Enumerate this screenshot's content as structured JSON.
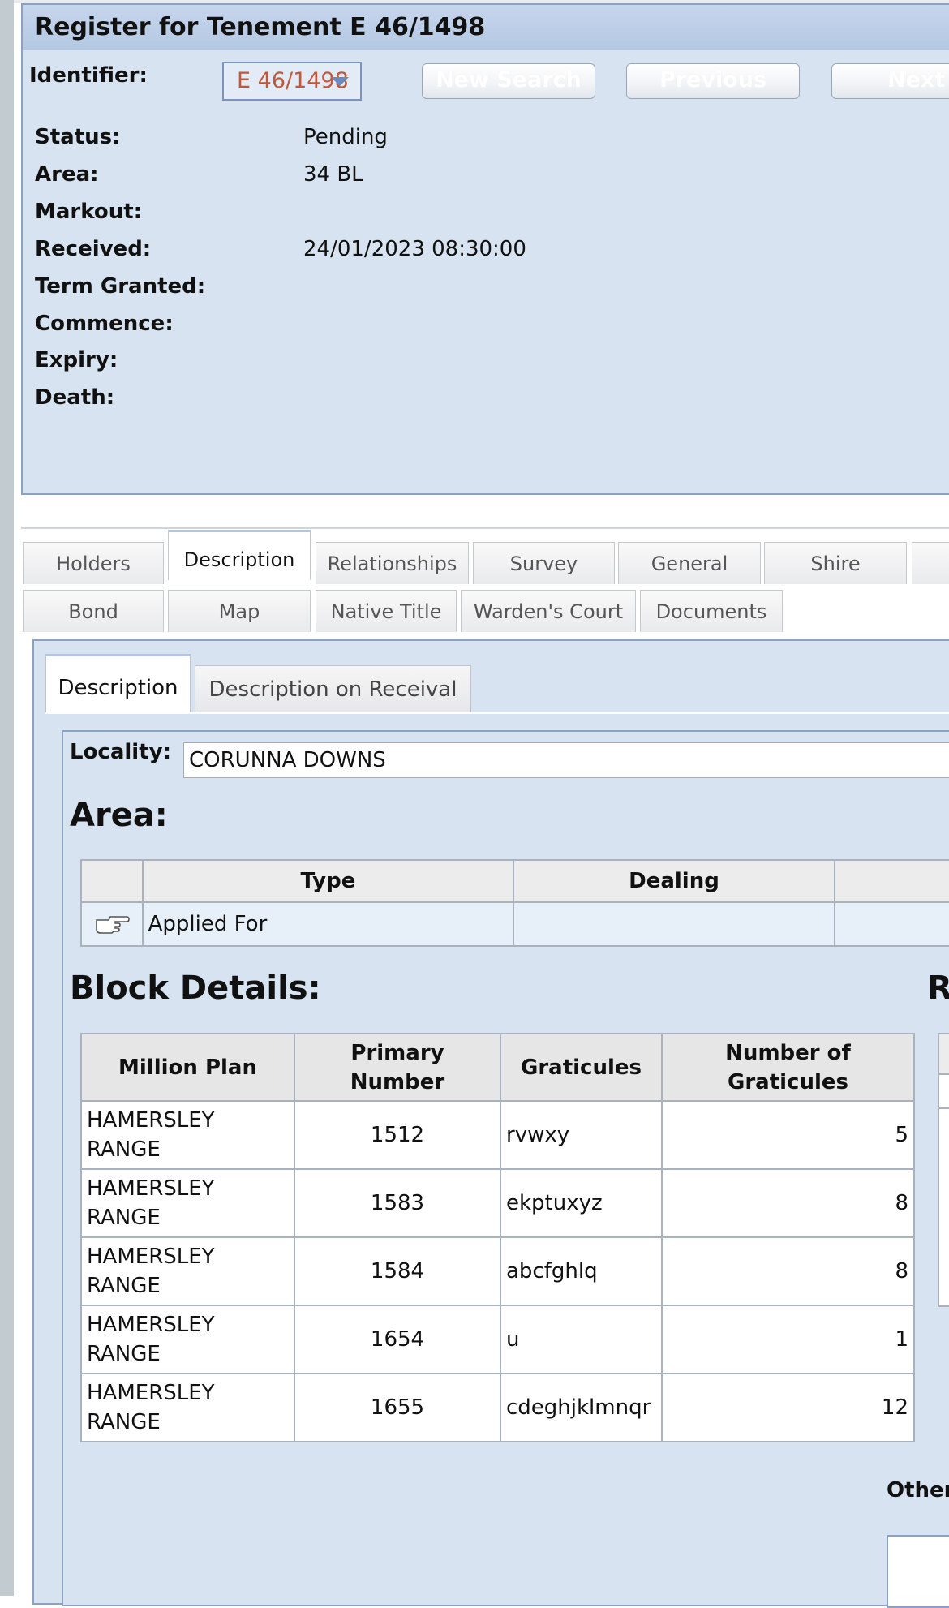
{
  "header": {
    "title": "Register for Tenement E 46/1498",
    "identifier_label": "Identifier:",
    "identifier_value": "E 46/1498",
    "buttons": {
      "new_search": "New Search",
      "previous": "Previous",
      "next": "Next"
    }
  },
  "fields": [
    {
      "label": "Status:",
      "value": "Pending"
    },
    {
      "label": "Area:",
      "value": "34 BL"
    },
    {
      "label": "Markout:",
      "value": ""
    },
    {
      "label": "Received:",
      "value": "24/01/2023 08:30:00"
    },
    {
      "label": "Term Granted:",
      "value": ""
    },
    {
      "label": "Commence:",
      "value": ""
    },
    {
      "label": "Expiry:",
      "value": ""
    },
    {
      "label": "Death:",
      "value": ""
    }
  ],
  "tabs": {
    "row1": [
      "Holders",
      "Description",
      "Relationships",
      "Survey",
      "General",
      "Shire"
    ],
    "row2": [
      "Bond",
      "Map",
      "Native Title",
      "Warden's Court",
      "Documents"
    ],
    "active": "Description"
  },
  "subtabs": [
    "Description",
    "Description on Receival"
  ],
  "locality": {
    "label": "Locality:",
    "value": "CORUNNA DOWNS"
  },
  "area_section": {
    "title": "Area:",
    "columns": [
      "Type",
      "Dealing"
    ],
    "rows": [
      {
        "type": "Applied For",
        "dealing": ""
      }
    ]
  },
  "block_section": {
    "title": "Block Details:",
    "right_title_partial": "R",
    "columns": [
      "Million Plan",
      "Primary Number",
      "Graticules",
      "Number of Graticules"
    ],
    "rows": [
      {
        "plan": "HAMERSLEY RANGE",
        "number": "1512",
        "graticules": "rvwxy",
        "count": "5"
      },
      {
        "plan": "HAMERSLEY RANGE",
        "number": "1583",
        "graticules": "ekptuxyz",
        "count": "8"
      },
      {
        "plan": "HAMERSLEY RANGE",
        "number": "1584",
        "graticules": "abcfghlq",
        "count": "8"
      },
      {
        "plan": "HAMERSLEY RANGE",
        "number": "1654",
        "graticules": "u",
        "count": "1"
      },
      {
        "plan": "HAMERSLEY RANGE",
        "number": "1655",
        "graticules": "cdeghjklmnqr",
        "count": "12"
      }
    ]
  },
  "other_label": "Other"
}
